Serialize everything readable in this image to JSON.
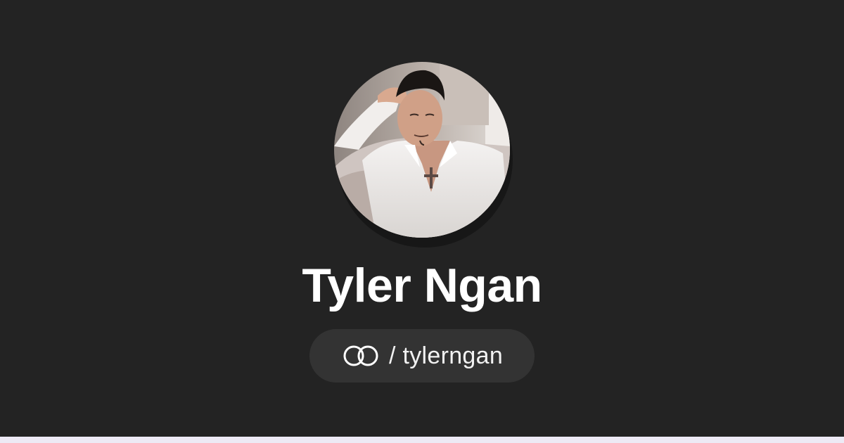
{
  "profile": {
    "display_name": "Tyler Ngan",
    "handle_separator": "/",
    "username": "tylerngan",
    "handle_text": "/ tylerngan"
  },
  "avatar": {
    "description_icon": "profile-photo"
  },
  "icons": {
    "brand": "linked-rings-icon"
  },
  "colors": {
    "background": "#232323",
    "pill_background": "#333333",
    "name_text": "#ffffff",
    "bottom_strip": "#edeaf5"
  }
}
